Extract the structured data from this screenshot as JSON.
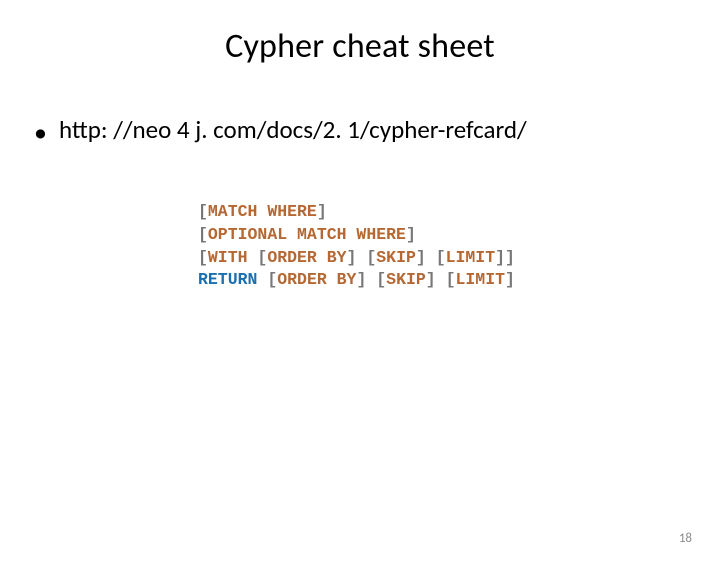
{
  "title": "Cypher cheat sheet",
  "bullet": {
    "dot": "•",
    "text": "http: //neo 4 j. com/docs/2. 1/cypher-refcard/"
  },
  "code": {
    "l1": {
      "lb": "[",
      "k1": "MATCH WHERE",
      "rb": "]"
    },
    "l2": {
      "lb": "[",
      "k1": "OPTIONAL MATCH WHERE",
      "rb": "]"
    },
    "l3": {
      "lb1": "[",
      "k1": "WITH",
      "sp1": " ",
      "lb2": "[",
      "k2": "ORDER BY",
      "rb2": "]",
      "sp2": " ",
      "lb3": "[",
      "k3": "SKIP",
      "rb3": "]",
      "sp3": " ",
      "lb4": "[",
      "k4": "LIMIT",
      "rb4": "]]"
    },
    "l4": {
      "k1": "RETURN",
      "sp1": " ",
      "lb2": "[",
      "k2": "ORDER BY",
      "rb2": "]",
      "sp2": " ",
      "lb3": "[",
      "k3": "SKIP",
      "rb3": "]",
      "sp3": " ",
      "lb4": "[",
      "k4": "LIMIT",
      "rb4": "]"
    }
  },
  "page_number": "18"
}
